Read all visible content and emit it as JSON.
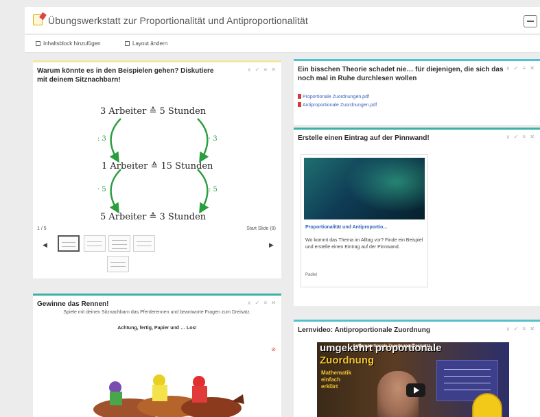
{
  "page": {
    "title": "Übungswerkstatt zur Proportionalität und Antiproportionalität",
    "toolbar": {
      "add_label": "Inhaltsblock hinzufügen",
      "layout_label": "Layout ändern"
    }
  },
  "icons": {
    "title": "notebook-icon",
    "collapse": "minus-icon",
    "card_actions": "x ✓ ≡ ✕"
  },
  "colors": {
    "accent_cyan": "#52c1cf",
    "accent_teal": "#3bb0a6",
    "accent_yellow": "#f2e6a0",
    "arrow_green": "#2a9d3f",
    "link_blue": "#3a62b8"
  },
  "card_discuss": {
    "title": "Warum könnte es in den Beispielen gehen? Diskutiere mit deinem Sitznachbarn!",
    "actions": "x ✓ ≡ ✕",
    "slide": {
      "row1": "3 Arbeiter ≙ 5 Stunden",
      "row2": "1 Arbeiter ≙ 15 Stunden",
      "row3": "5 Arbeiter ≙ 3 Stunden",
      "left1": ": 3",
      "right1": "· 3",
      "left2": "· 5",
      "right2": ": 5"
    },
    "counter": "1 / 5",
    "slideshow": "Start Slide (8)"
  },
  "card_theory": {
    "title": "Ein bisschen Theorie schadet nie… für diejenigen, die sich das noch mal in Ruhe durchlesen wollen",
    "actions": "x ✓ ≡ ✕",
    "files": [
      "Proportionale Zuordnungen.pdf",
      "Antiproportionale Zuordnungen.pdf"
    ]
  },
  "card_padlet": {
    "title": "Erstelle einen Eintrag auf der Pinnwand!",
    "actions": "x ✓ ≡ ✕",
    "post_title": "Proportionalität und Antiproportio...",
    "post_desc": "Wo kommt das Thema im Alltag vor? Finde ein Beispiel und erstelle einen Eintrag auf der Pinnwand.",
    "post_footer": "Padlet"
  },
  "card_game": {
    "title": "Gewinne das Rennen!",
    "actions": "x ✓ ≡ ✕",
    "subtitle": "Spiele mit deinen Sitznachbarn das Pferderennen und beantworte Fragen zum Dreisatz.",
    "bold_line": "Achtung, fertig, Papier und … Los!",
    "badge": "⊘"
  },
  "card_video": {
    "title": "Lernvideo: Antiproportionale Zuordnung",
    "actions": "x ✓ ≡ ✕",
    "topic": "umgekehrt proportionale",
    "caption": "Antiproportionale Zuordnung (Dreisatz)",
    "zuordnung": "Zuordnung",
    "sub1": "Mathematik",
    "sub2": "einfach",
    "sub3": "erklärt"
  }
}
